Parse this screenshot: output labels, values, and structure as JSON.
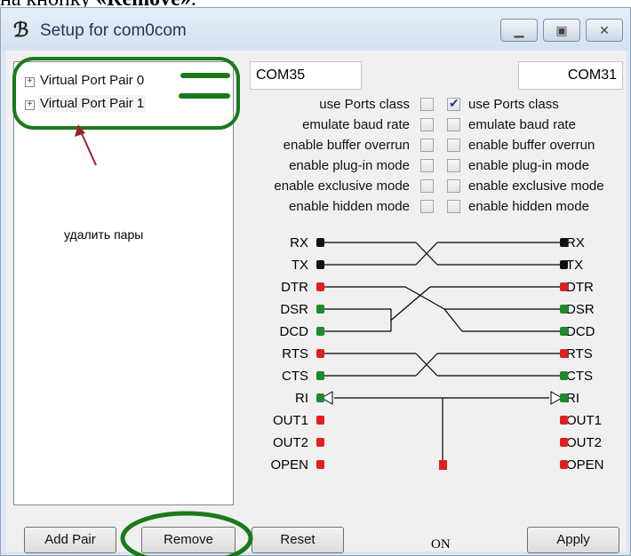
{
  "doc": {
    "prefix": "на кнопку ",
    "bold": "«Remove»",
    "suffix": "."
  },
  "window": {
    "title": "Setup for com0com",
    "icon": "com0com-icon",
    "controls": [
      "minimize",
      "maximize",
      "close"
    ]
  },
  "tree": {
    "items": [
      {
        "label": "Virtual Port Pair 0"
      },
      {
        "label": "Virtual Port Pair 1"
      }
    ]
  },
  "annotation": {
    "text": "удалить пары",
    "color": "#1a7a1a",
    "arrow_color": "#a02020"
  },
  "ports": {
    "left_name": "COM35",
    "right_name": "COM31"
  },
  "options": [
    {
      "label": "use Ports class",
      "left": false,
      "right": true
    },
    {
      "label": "emulate baud rate",
      "left": false,
      "right": false
    },
    {
      "label": "enable buffer overrun",
      "left": false,
      "right": false
    },
    {
      "label": "enable plug-in mode",
      "left": false,
      "right": false
    },
    {
      "label": "enable exclusive mode",
      "left": false,
      "right": false
    },
    {
      "label": "enable hidden mode",
      "left": false,
      "right": false
    }
  ],
  "pins": [
    {
      "name": "RX",
      "color": "#111111"
    },
    {
      "name": "TX",
      "color": "#111111"
    },
    {
      "name": "DTR",
      "color": "#e02020"
    },
    {
      "name": "DSR",
      "color": "#1a8a2a"
    },
    {
      "name": "DCD",
      "color": "#1a8a2a"
    },
    {
      "name": "RTS",
      "color": "#e02020"
    },
    {
      "name": "CTS",
      "color": "#1a8a2a"
    },
    {
      "name": "RI",
      "color": "#1a8a2a"
    },
    {
      "name": "OUT1",
      "color": "#e02020"
    },
    {
      "name": "OUT2",
      "color": "#e02020"
    },
    {
      "name": "OPEN",
      "color": "#e02020"
    }
  ],
  "on_label": "ON",
  "buttons": {
    "add_pair": "Add Pair",
    "remove": "Remove",
    "reset": "Reset",
    "apply": "Apply"
  }
}
